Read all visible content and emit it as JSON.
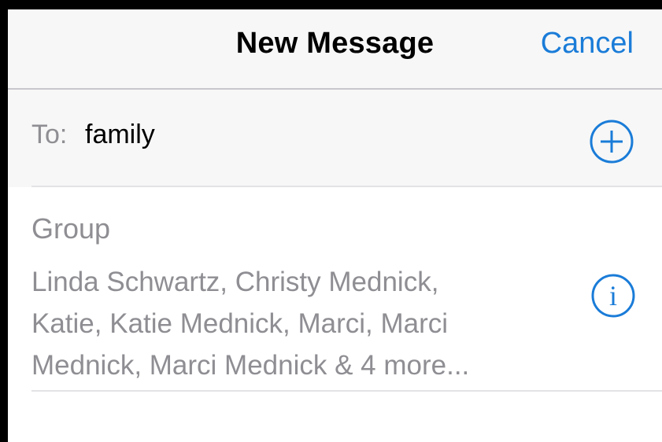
{
  "navbar": {
    "title": "New Message",
    "cancel_label": "Cancel"
  },
  "recipient": {
    "to_label": "To:",
    "to_value": "family",
    "add_icon": "plus-circle-icon"
  },
  "suggestion": {
    "title": "Group",
    "members_line_1": "Linda Schwartz, Christy Mednick,",
    "members_line_2": "Katie, Katie Mednick, Marci, Marci",
    "members_line_3": "Mednick, Marci Mednick & 4 more...",
    "info_icon": "info-circle-icon"
  },
  "colors": {
    "accent": "#1a7cd8",
    "secondary_text": "#8e8e93",
    "bar_background": "#f7f7f7"
  }
}
